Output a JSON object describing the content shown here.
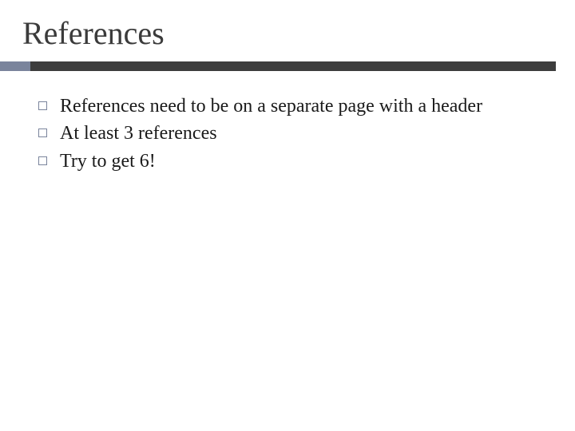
{
  "slide": {
    "title": "References",
    "bullets": [
      "References need to be on a separate page with a header",
      "At least 3 references",
      "Try to get 6!"
    ]
  }
}
